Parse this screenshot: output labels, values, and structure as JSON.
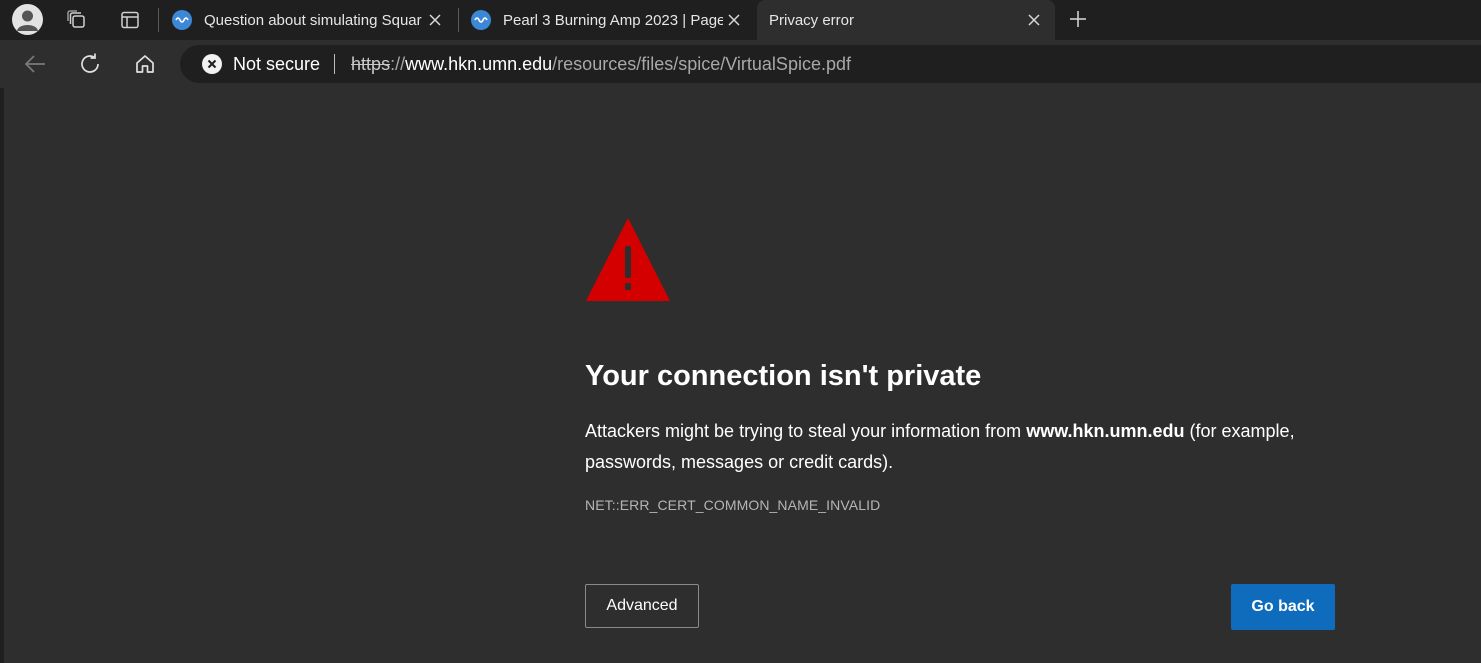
{
  "tabs": [
    {
      "title": "Question about simulating Squar",
      "active": false,
      "favicon": "wave-icon"
    },
    {
      "title": "Pearl 3 Burning Amp 2023 | Page",
      "active": false,
      "favicon": "wave-icon"
    },
    {
      "title": "Privacy error",
      "active": true,
      "favicon": "none"
    }
  ],
  "address_bar": {
    "security_label": "Not secure",
    "url_scheme": "https",
    "url_separator": "://",
    "url_host": "www.hkn.umn.edu",
    "url_path": "/resources/files/spice/VirtualSpice.pdf"
  },
  "error_page": {
    "headline": "Your connection isn't private",
    "message_before": "Attackers might be trying to steal your information from ",
    "message_host": "www.hkn.umn.edu",
    "message_after": " (for example, passwords, messages or credit cards).",
    "error_code": "NET::ERR_CERT_COMMON_NAME_INVALID",
    "advanced_label": "Advanced",
    "go_back_label": "Go back"
  },
  "colors": {
    "warning_red": "#d40000",
    "primary_button": "#0f6cbd",
    "page_background": "#2e2e2e",
    "tabstrip_background": "#1f1f1f"
  }
}
